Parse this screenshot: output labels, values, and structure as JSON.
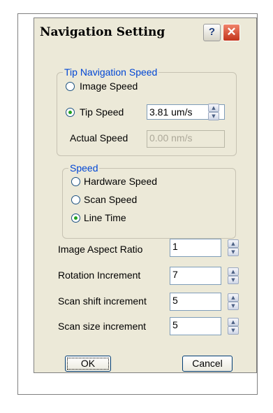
{
  "window": {
    "title": "Navigation Setting"
  },
  "titlebar": {
    "help_label": "?",
    "close_label": "✕"
  },
  "tip_nav": {
    "legend": "Tip Navigation Speed",
    "image_speed_label": "Image Speed",
    "tip_speed_label": "Tip Speed",
    "tip_speed_value": "3.81 um/s",
    "actual_speed_label": "Actual Speed",
    "actual_speed_value": "0.00 nm/s",
    "selected": "Tip Speed"
  },
  "speed": {
    "legend": "Speed",
    "options": [
      "Hardware Speed",
      "Scan Speed",
      "Line Time"
    ],
    "selected": "Line Time"
  },
  "fields": [
    {
      "label": "Image Aspect Ratio",
      "value": "1"
    },
    {
      "label": "Rotation Increment",
      "value": "7"
    },
    {
      "label": "Scan shift increment",
      "value": "5"
    },
    {
      "label": "Scan size increment",
      "value": "5"
    }
  ],
  "buttons": {
    "ok": "OK",
    "cancel": "Cancel"
  },
  "icons": {
    "help": "help-icon",
    "close": "close-icon",
    "spin_up": "arrow-up-icon",
    "spin_down": "arrow-down-icon"
  },
  "colors": {
    "dialog_bg": "#ece9d8",
    "group_legend": "#0046d5",
    "radio_dot": "#21a121",
    "close_button": "#c2341b"
  }
}
